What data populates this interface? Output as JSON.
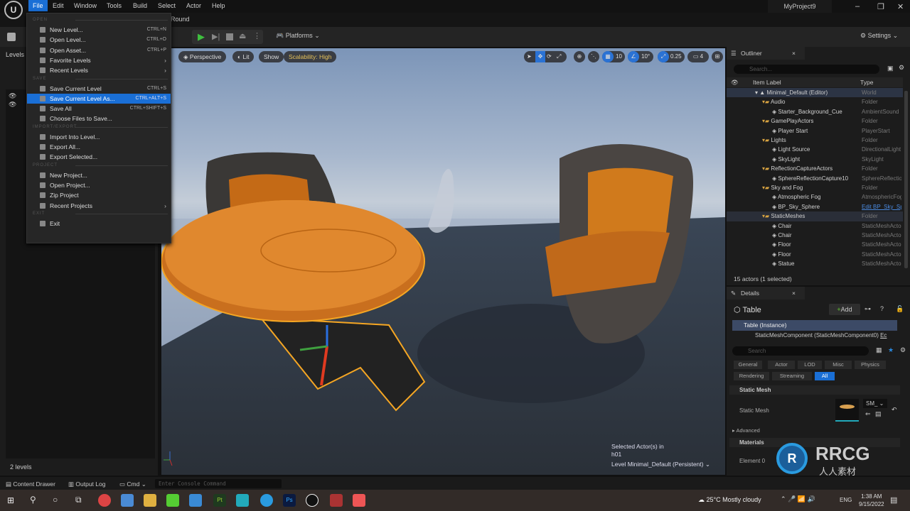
{
  "menubar": {
    "items": [
      "File",
      "Edit",
      "Window",
      "Tools",
      "Build",
      "Select",
      "Actor",
      "Help"
    ],
    "project": "MyProject9",
    "level_tab": "Round"
  },
  "toolbar": {
    "platforms": "Platforms",
    "settings": "Settings"
  },
  "file_menu": {
    "sections": [
      {
        "title": "OPEN",
        "items": [
          {
            "label": "New Level...",
            "shortcut": "CTRL+N"
          },
          {
            "label": "Open Level...",
            "shortcut": "CTRL+O"
          },
          {
            "label": "Open Asset...",
            "shortcut": "CTRL+P"
          },
          {
            "label": "Favorite Levels",
            "submenu": true
          },
          {
            "label": "Recent Levels",
            "submenu": true
          }
        ]
      },
      {
        "title": "SAVE",
        "items": [
          {
            "label": "Save Current Level",
            "shortcut": "CTRL+S"
          },
          {
            "label": "Save Current Level As...",
            "shortcut": "CTRL+ALT+S",
            "highlighted": true
          },
          {
            "label": "Save All",
            "shortcut": "CTRL+SHIFT+S"
          },
          {
            "label": "Choose Files to Save..."
          }
        ]
      },
      {
        "title": "IMPORT/EXPORT",
        "items": [
          {
            "label": "Import Into Level..."
          },
          {
            "label": "Export All..."
          },
          {
            "label": "Export Selected..."
          }
        ]
      },
      {
        "title": "PROJECT",
        "items": [
          {
            "label": "New Project..."
          },
          {
            "label": "Open Project..."
          },
          {
            "label": "Zip Project"
          },
          {
            "label": "Recent Projects",
            "submenu": true
          }
        ]
      },
      {
        "title": "EXIT",
        "items": [
          {
            "label": "Exit"
          }
        ]
      }
    ]
  },
  "levels": {
    "tab": "Levels",
    "count": "2 levels"
  },
  "viewport": {
    "perspective": "Perspective",
    "lit": "Lit",
    "show": "Show",
    "scalability": "Scalability: High",
    "grid": "10",
    "angle": "10°",
    "scale": "0.25",
    "camera_speed": "4",
    "selected_line1": "Selected Actor(s) in",
    "selected_line2": "h01",
    "level_label": "Level",
    "level_value": "Minimal_Default (Persistent)"
  },
  "outliner": {
    "tab": "Outliner",
    "search_placeholder": "Search...",
    "col_label": "Item Label",
    "col_type": "Type",
    "rows": [
      {
        "label": "Minimal_Default (Editor)",
        "type": "World",
        "depth": 0
      },
      {
        "label": "Audio",
        "type": "Folder",
        "depth": 1
      },
      {
        "label": "Starter_Background_Cue",
        "type": "AmbientSound",
        "depth": 2
      },
      {
        "label": "GamePlayActors",
        "type": "Folder",
        "depth": 1
      },
      {
        "label": "Player Start",
        "type": "PlayerStart",
        "depth": 2
      },
      {
        "label": "Lights",
        "type": "Folder",
        "depth": 1
      },
      {
        "label": "Light Source",
        "type": "DirectionalLight",
        "depth": 2
      },
      {
        "label": "SkyLight",
        "type": "SkyLight",
        "depth": 2
      },
      {
        "label": "ReflectionCaptureActors",
        "type": "Folder",
        "depth": 1
      },
      {
        "label": "SphereReflectionCapture10",
        "type": "SphereReflectionCapture",
        "depth": 2
      },
      {
        "label": "Sky and Fog",
        "type": "Folder",
        "depth": 1
      },
      {
        "label": "Atmospheric Fog",
        "type": "AtmosphericFog",
        "depth": 2
      },
      {
        "label": "BP_Sky_Sphere",
        "type": "Edit BP_Sky_Sphere",
        "depth": 2,
        "link": true
      },
      {
        "label": "StaticMeshes",
        "type": "Folder",
        "depth": 1,
        "hover": true
      },
      {
        "label": "Chair",
        "type": "StaticMeshActor",
        "depth": 2
      },
      {
        "label": "Chair",
        "type": "StaticMeshActor",
        "depth": 2
      },
      {
        "label": "Floor",
        "type": "StaticMeshActor",
        "depth": 2
      },
      {
        "label": "Floor",
        "type": "StaticMeshActor",
        "depth": 2
      },
      {
        "label": "Statue",
        "type": "StaticMeshActor",
        "depth": 2
      }
    ],
    "status": "15 actors (1 selected)"
  },
  "details": {
    "tab": "Details",
    "actor": "Table",
    "add": "Add",
    "instance": "Table (Instance)",
    "component": "StaticMeshComponent (StaticMeshComponent0)",
    "component_edit": "Ec",
    "search_placeholder": "Search",
    "filters": [
      "General",
      "Actor",
      "LOD",
      "Misc",
      "Physics",
      "Rendering",
      "Streaming",
      "All"
    ],
    "active_filter": "All",
    "static_mesh_section": "Static Mesh",
    "static_mesh_label": "Static Mesh",
    "static_mesh_value": "SM_",
    "advanced": "Advanced",
    "materials_section": "Materials",
    "element0": "Element 0"
  },
  "bottombar": {
    "content_drawer": "Content Drawer",
    "output_log": "Output Log",
    "cmd": "Cmd",
    "console_placeholder": "Enter Console Command"
  },
  "taskbar": {
    "weather": "25°C  Mostly cloudy",
    "lang": "ENG",
    "time": "1:38 AM",
    "date": "9/15/2022"
  },
  "watermark": {
    "text": "RRCG",
    "sub": "人人素材"
  },
  "colors": {
    "accent": "#1a6fd6",
    "selection_orange": "#f5a623",
    "scalability": "#e6c25a"
  }
}
